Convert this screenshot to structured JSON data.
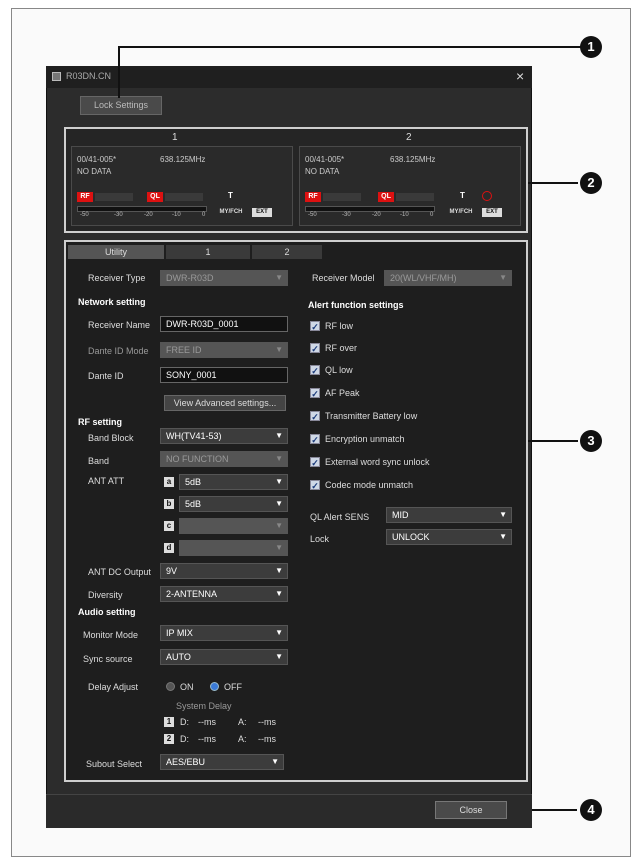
{
  "window": {
    "title": "R03DN.CN",
    "close_glyph": "×"
  },
  "lock_settings_label": "Lock Settings",
  "callouts": [
    "1",
    "2",
    "3",
    "4"
  ],
  "channels": [
    {
      "number": "1",
      "group": "00/41-005*",
      "freq": "638.125MHz",
      "status": "NO DATA",
      "rf": "RF",
      "ql": "QL",
      "scale": [
        "-50",
        "-30",
        "-20",
        "-10",
        "0"
      ],
      "mode": "MY/FCH",
      "tag": "EXT"
    },
    {
      "number": "2",
      "group": "00/41-005*",
      "freq": "638.125MHz",
      "status": "NO DATA",
      "rf": "RF",
      "ql": "QL",
      "scale": [
        "-50",
        "-30",
        "-20",
        "-10",
        "0"
      ],
      "mode": "MY/FCH",
      "tag": "EXT"
    }
  ],
  "tabs": [
    "Utility",
    "1",
    "2"
  ],
  "left": {
    "receiver_type_label": "Receiver Type",
    "receiver_type_value": "DWR-R03D",
    "network_header": "Network setting",
    "receiver_name_label": "Receiver Name",
    "receiver_name_value": "DWR-R03D_0001",
    "dante_mode_label": "Dante ID Mode",
    "dante_mode_value": "FREE ID",
    "dante_id_label": "Dante ID",
    "dante_id_value": "SONY_0001",
    "view_advanced": "View Advanced settings...",
    "rf_header": "RF setting",
    "band_block_label": "Band Block",
    "band_block_value": "WH(TV41-53)",
    "band_label": "Band",
    "band_value": "NO FUNCTION",
    "ant_att_label": "ANT ATT",
    "ant_att": [
      {
        "letter": "a",
        "value": "5dB"
      },
      {
        "letter": "b",
        "value": "5dB"
      },
      {
        "letter": "c",
        "value": ""
      },
      {
        "letter": "d",
        "value": ""
      }
    ],
    "ant_dc_label": "ANT DC Output",
    "ant_dc_value": "9V",
    "diversity_label": "Diversity",
    "diversity_value": "2-ANTENNA",
    "audio_header": "Audio setting",
    "monitor_mode_label": "Monitor Mode",
    "monitor_mode_value": "IP MIX",
    "sync_source_label": "Sync source",
    "sync_source_value": "AUTO",
    "delay_adjust_label": "Delay Adjust",
    "on_label": "ON",
    "off_label": "OFF",
    "system_delay_label": "System Delay",
    "delay_rows": [
      {
        "num": "1",
        "d": "D:",
        "d_val": "--ms",
        "a": "A:",
        "a_val": "--ms"
      },
      {
        "num": "2",
        "d": "D:",
        "d_val": "--ms",
        "a": "A:",
        "a_val": "--ms"
      }
    ],
    "subout_label": "Subout Select",
    "subout_value": "AES/EBU"
  },
  "right": {
    "receiver_model_label": "Receiver Model",
    "receiver_model_value": "20(WL/VHF/MH)",
    "alert_header": "Alert function settings",
    "alerts": [
      "RF low",
      "RF over",
      "QL low",
      "AF Peak",
      "Transmitter Battery low",
      "Encryption unmatch",
      "External word sync unlock",
      "Codec mode unmatch"
    ],
    "ql_alert_label": "QL Alert SENS",
    "ql_alert_value": "MID",
    "lock_label": "Lock",
    "lock_value": "UNLOCK"
  },
  "close_label": "Close",
  "arrow_glyph": "▼",
  "check_glyph": "✓",
  "antenna_glyph": "T",
  "colors": {
    "alert_red": "#dd1111",
    "radio_on": "#3b7bd8",
    "dialog_bg": "#2c2c2c"
  }
}
